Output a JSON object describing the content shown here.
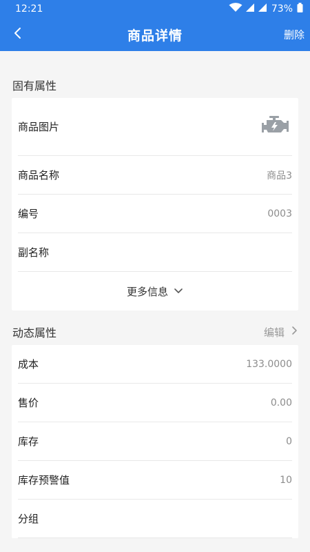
{
  "status": {
    "time": "12:21",
    "battery_percent": "73%"
  },
  "app_bar": {
    "title": "商品详情",
    "delete_label": "删除"
  },
  "fixed_properties": {
    "title": "固有属性",
    "image_label": "商品图片",
    "image_icon": "engine-icon",
    "rows": [
      {
        "label": "商品名称",
        "value": "商品3"
      },
      {
        "label": "编号",
        "value": "0003"
      },
      {
        "label": "副名称",
        "value": ""
      }
    ],
    "more_label": "更多信息"
  },
  "dynamic_properties": {
    "title": "动态属性",
    "edit_label": "编辑",
    "rows": [
      {
        "label": "成本",
        "value": "133.0000"
      },
      {
        "label": "售价",
        "value": "0.00"
      },
      {
        "label": "库存",
        "value": "0"
      },
      {
        "label": "库存预警值",
        "value": "10"
      },
      {
        "label": "分组",
        "value": ""
      }
    ]
  },
  "colors": {
    "primary": "#2e7fe8",
    "background": "#f5f5f5",
    "card": "#ffffff",
    "secondary_text": "#8c8c8c"
  }
}
